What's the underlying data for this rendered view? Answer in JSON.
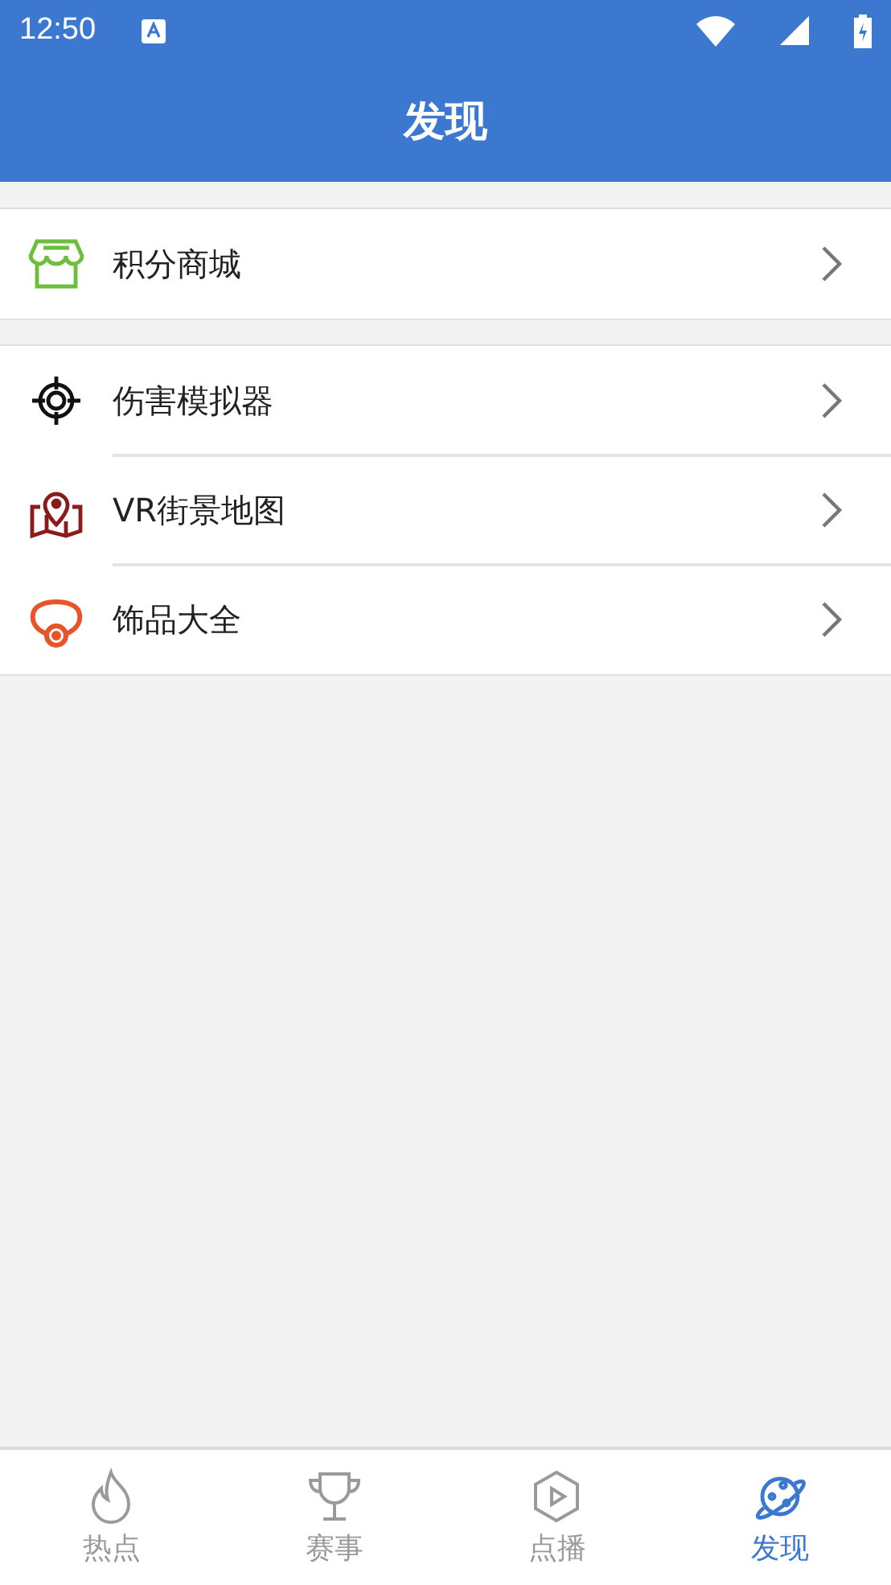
{
  "status_bar": {
    "time": "12:50"
  },
  "header": {
    "title": "发现"
  },
  "groups": [
    {
      "items": [
        {
          "kind": "shop",
          "label": "积分商城",
          "color": "#6cbf3a"
        }
      ]
    },
    {
      "items": [
        {
          "kind": "target",
          "label": "伤害模拟器",
          "color": "#111111"
        },
        {
          "kind": "map",
          "label": "VR街景地图",
          "color": "#8b1a1a"
        },
        {
          "kind": "ornament",
          "label": "饰品大全",
          "color": "#e8542a"
        }
      ]
    }
  ],
  "tabs": [
    {
      "kind": "fire",
      "label": "热点",
      "selected": false
    },
    {
      "kind": "trophy",
      "label": "赛事",
      "selected": false
    },
    {
      "kind": "play",
      "label": "点播",
      "selected": false
    },
    {
      "kind": "planet",
      "label": "发现",
      "selected": true
    }
  ]
}
